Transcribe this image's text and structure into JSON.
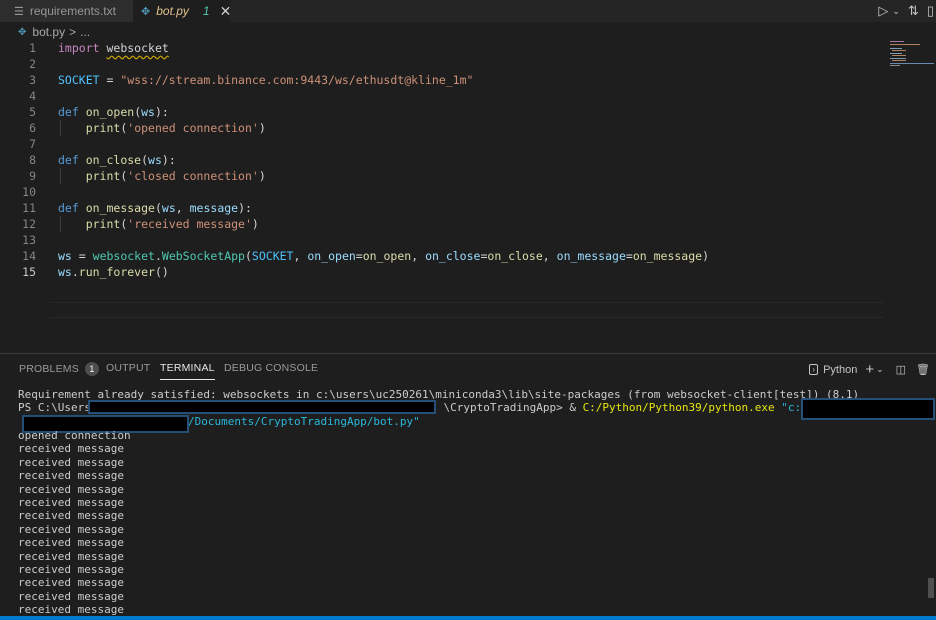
{
  "tabs": [
    {
      "icon": "lines-icon",
      "label": "requirements.txt"
    },
    {
      "icon": "python-icon",
      "label": "bot.py",
      "modified": "1",
      "close": "✕"
    }
  ],
  "breadcrumb": {
    "file": "bot.py",
    "sep": ">",
    "rest": "..."
  },
  "editor": {
    "lines": [
      "1",
      "2",
      "3",
      "4",
      "5",
      "6",
      "7",
      "8",
      "9",
      "10",
      "11",
      "12",
      "13",
      "14",
      "15"
    ],
    "code": {
      "l1_kw": "import",
      "l1_mod": "websocket",
      "l3_var": "SOCKET",
      "l3_op": " = ",
      "l3_str": "\"wss://stream.binance.com:9443/ws/ethusdt@kline_1m\"",
      "l5_kw": "def",
      "l5_fn": "on_open",
      "l5_p": "ws",
      "l6_fn": "print",
      "l6_str": "'opened connection'",
      "l8_kw": "def",
      "l8_fn": "on_close",
      "l8_p": "ws",
      "l9_fn": "print",
      "l9_str": "'closed connection'",
      "l11_kw": "def",
      "l11_fn": "on_message",
      "l11_p1": "ws",
      "l11_p2": "message",
      "l12_fn": "print",
      "l12_str": "'received message'",
      "l14_ws": "ws",
      "l14_mod": "websocket",
      "l14_cls": "WebSocketApp",
      "l14_const": "SOCKET",
      "l14_k1": "on_open",
      "l14_v1": "on_open",
      "l14_k2": "on_close",
      "l14_v2": "on_close",
      "l14_k3": "on_message",
      "l14_v3": "on_message",
      "l15_ws": "ws",
      "l15_fn": "run_forever"
    }
  },
  "panel": {
    "tabs": [
      {
        "label": "PROBLEMS",
        "badge": "1"
      },
      {
        "label": "OUTPUT"
      },
      {
        "label": "TERMINAL"
      },
      {
        "label": "DEBUG CONSOLE"
      }
    ],
    "shell": "Python",
    "terminal": {
      "line1": "Requirement already satisfied: websockets in c:\\users\\uc250261\\miniconda3\\lib\\site-packages (from websocket-client[test]) (8.1)",
      "ps_prefix": "PS C:\\Users\\",
      "ps_mid": "\\CryptoTradingApp> & ",
      "ps_exe": "C:/Python/Python39/python.exe",
      "ps_arg": " \"c:/Users/",
      "ps_arg2": "/Documents/CryptoTradingApp/bot.py\"",
      "opened": "opened connection",
      "messages": [
        "received message",
        "received message",
        "received message",
        "received message",
        "received message",
        "received message",
        "received message",
        "received message",
        "received message",
        "received message",
        "received message",
        "received message",
        "received message"
      ]
    }
  }
}
